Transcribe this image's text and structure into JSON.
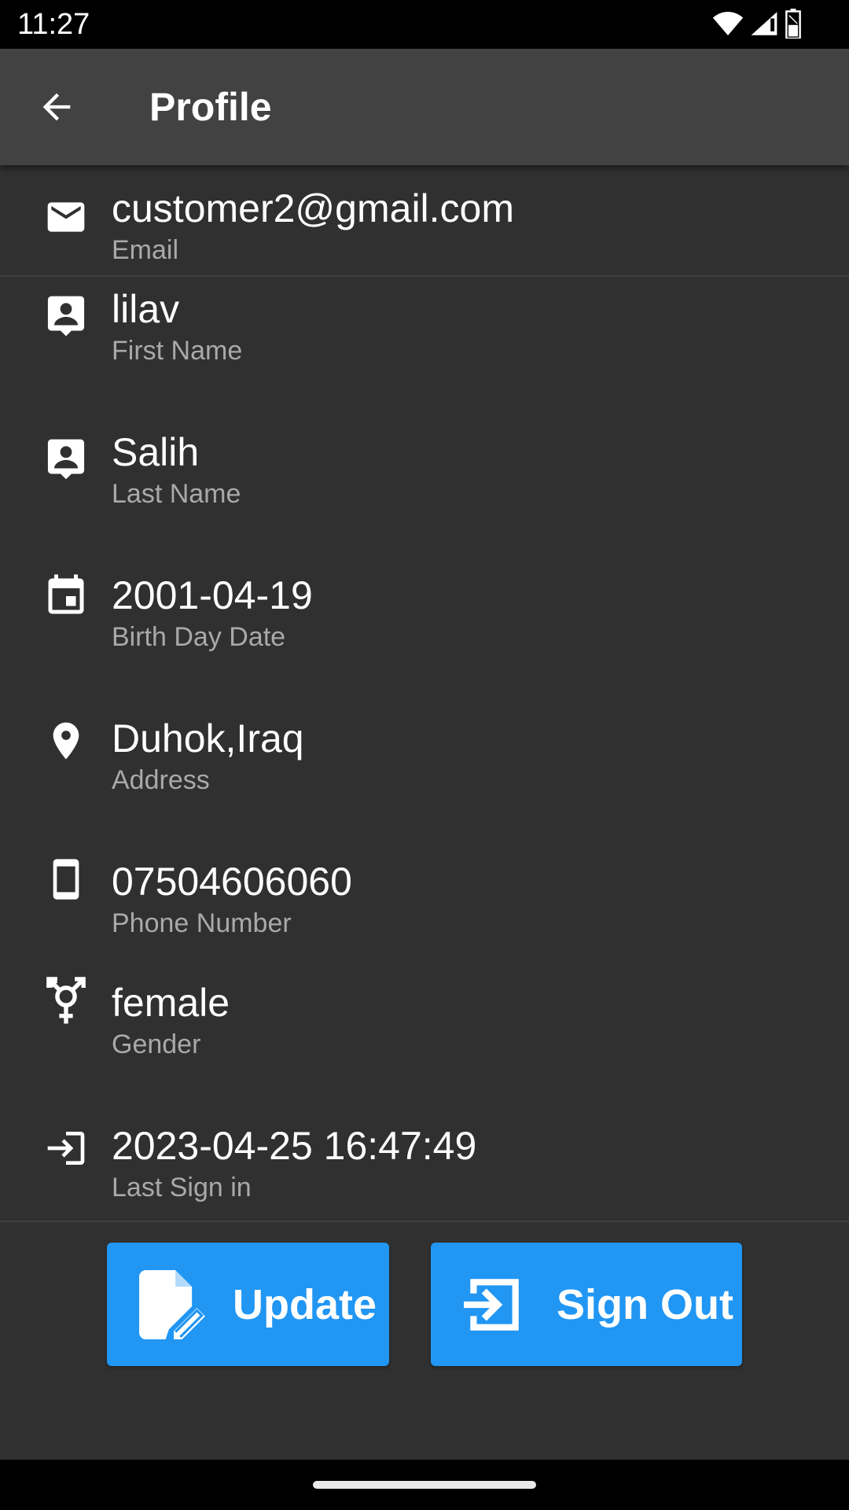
{
  "status_bar": {
    "time": "11:27",
    "icons": [
      "wifi-icon",
      "signal-icon",
      "battery-icon"
    ]
  },
  "app_bar": {
    "title": "Profile",
    "back_icon": "arrow-back-icon"
  },
  "profile_fields": [
    {
      "icon": "email-icon",
      "value": "customer2@gmail.com",
      "label": "Email"
    },
    {
      "icon": "contact-icon",
      "value": "lilav",
      "label": "First Name"
    },
    {
      "icon": "contact-icon",
      "value": "Salih",
      "label": "Last Name"
    },
    {
      "icon": "calendar-icon",
      "value": "2001-04-19",
      "label": "Birth Day Date"
    },
    {
      "icon": "location-pin-icon",
      "value": "Duhok,Iraq",
      "label": "Address"
    },
    {
      "icon": "phone-icon",
      "value": "07504606060",
      "label": "Phone Number"
    },
    {
      "icon": "gender-icon",
      "value": "female",
      "label": "Gender"
    },
    {
      "icon": "login-icon",
      "value": "2023-04-25 16:47:49",
      "label": "Last Sign in"
    }
  ],
  "actions": {
    "update_label": "Update",
    "update_icon": "edit-document-icon",
    "signout_label": "Sign Out",
    "signout_icon": "exit-icon"
  },
  "colors": {
    "background": "#303030",
    "app_bar": "#424242",
    "accent": "#2196f3",
    "label_text": "#a9a9a9"
  }
}
